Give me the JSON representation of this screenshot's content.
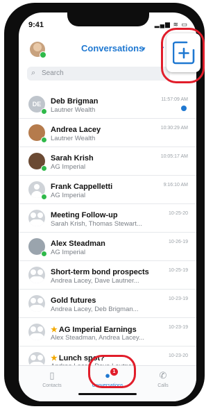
{
  "status_bar": {
    "time": "9:41",
    "icons": "▂▄▆ ≋ ▭"
  },
  "header": {
    "title": "Conversations",
    "caret": "▾",
    "sort_icon": "sort-icon"
  },
  "search": {
    "placeholder": "Search"
  },
  "colors": {
    "accent": "#1f78d1",
    "highlight": "#e11d2a",
    "online": "#2fb94a",
    "star": "#f2a900"
  },
  "conversations": [
    {
      "name": "Deb Brigman",
      "sub": "Lautner Wealth",
      "time": "11:57:09 AM",
      "avatar": "initials",
      "initials": "DE",
      "online": true,
      "unread": true,
      "starred": false
    },
    {
      "name": "Andrea Lacey",
      "sub": "Lautner Wealth",
      "time": "10:30:29 AM",
      "avatar": "photo1",
      "online": true,
      "unread": false,
      "starred": false
    },
    {
      "name": "Sarah Krish",
      "sub": "AG Imperial",
      "time": "10:05:17 AM",
      "avatar": "photo2",
      "online": true,
      "unread": false,
      "starred": false
    },
    {
      "name": "Frank Cappelletti",
      "sub": "AG Imperial",
      "time": "9:16:10 AM",
      "avatar": "person",
      "online": true,
      "unread": false,
      "starred": false
    },
    {
      "name": "Meeting Follow-up",
      "sub": "Sarah Krish, Thomas Stewart...",
      "time": "10-25-20",
      "avatar": "group",
      "online": false,
      "unread": false,
      "starred": false
    },
    {
      "name": "Alex Steadman",
      "sub": "AG Imperial",
      "time": "10-26-19",
      "avatar": "photo3",
      "online": true,
      "unread": false,
      "starred": false
    },
    {
      "name": "Short-term bond prospects",
      "sub": "Andrea Lacey, Dave Lautner...",
      "time": "10-25-19",
      "avatar": "group",
      "online": false,
      "unread": false,
      "starred": false
    },
    {
      "name": "Gold futures",
      "sub": "Andrea Lacey, Deb Brigman...",
      "time": "10-23-19",
      "avatar": "group",
      "online": false,
      "unread": false,
      "starred": false
    },
    {
      "name": "AG Imperial Earnings",
      "sub": "Alex Steadman, Andrea Lacey...",
      "time": "10-23-19",
      "avatar": "group",
      "online": false,
      "unread": false,
      "starred": true
    },
    {
      "name": "Lunch spot?",
      "sub": "Andrea Lacey, Dave Lautner...",
      "time": "10-23-20",
      "avatar": "group",
      "online": false,
      "unread": false,
      "starred": true
    }
  ],
  "tabs": [
    {
      "label": "Contacts",
      "icon": "contacts-icon",
      "glyph": "▯",
      "active": false,
      "badge": ""
    },
    {
      "label": "Conversations",
      "icon": "chat-bubble-icon",
      "glyph": "●",
      "active": true,
      "badge": "1"
    },
    {
      "label": "Calls",
      "icon": "phone-icon",
      "glyph": "✆",
      "active": false,
      "badge": ""
    }
  ]
}
